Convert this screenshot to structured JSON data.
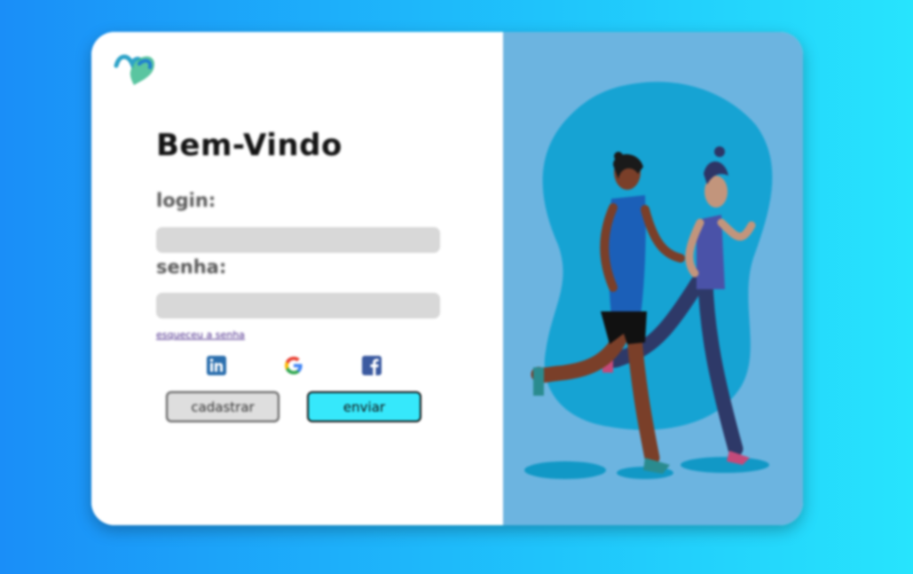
{
  "login_card": {
    "title": "Bem-Vindo",
    "login_label": "login:",
    "password_label": "senha:",
    "forgot_password": "esqueceu a senha",
    "register_button": "cadastrar",
    "submit_button": "enviar",
    "social_icons": [
      "linkedin-icon",
      "google-icon",
      "facebook-icon"
    ]
  },
  "illustration": {
    "subject": "runners-illustration",
    "colors": {
      "panel_background": "#6cb4e0",
      "blob": "#16a3d3",
      "shadow": "#1198c6"
    }
  },
  "colors": {
    "background_gradient_start": "#1a8ef8",
    "background_gradient_end": "#27e4fd",
    "submit_button": "#36e8fb",
    "input_fill": "#d8d8d8"
  }
}
